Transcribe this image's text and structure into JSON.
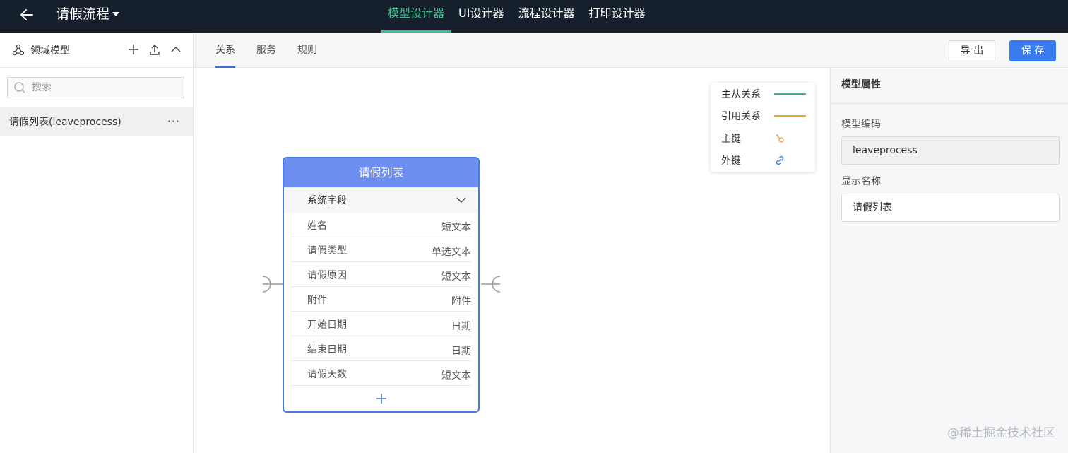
{
  "app": {
    "title": "请假流程",
    "nav_tabs": [
      "模型设计器",
      "UI设计器",
      "流程设计器",
      "打印设计器"
    ],
    "active_tab": "模型设计器"
  },
  "left_panel": {
    "title": "领域模型",
    "search_placeholder": "搜索",
    "items": [
      {
        "label": "请假列表(leaveprocess)"
      }
    ]
  },
  "sub_tabs": [
    "关系",
    "服务",
    "规则"
  ],
  "toolbar": {
    "export_label": "导 出",
    "save_label": "保 存"
  },
  "legend": {
    "items": [
      {
        "label": "主从关系",
        "icon": "solid-line",
        "color": "#4caf8a"
      },
      {
        "label": "引用关系",
        "icon": "solid-line",
        "color": "#e8a53a"
      },
      {
        "label": "主键",
        "icon": "key-icon",
        "color": "#e8a53a"
      },
      {
        "label": "外键",
        "icon": "link-icon",
        "color": "#3a7bf0"
      }
    ]
  },
  "entity": {
    "title": "请假列表",
    "group_label": "系统字段",
    "fields": [
      {
        "name": "姓名",
        "type": "短文本"
      },
      {
        "name": "请假类型",
        "type": "单选文本"
      },
      {
        "name": "请假原因",
        "type": "短文本"
      },
      {
        "name": "附件",
        "type": "附件"
      },
      {
        "name": "开始日期",
        "type": "日期"
      },
      {
        "name": "结束日期",
        "type": "日期"
      },
      {
        "name": "请假天数",
        "type": "短文本"
      }
    ]
  },
  "properties": {
    "title": "模型属性",
    "code_label": "模型编码",
    "code_value": "leaveprocess",
    "name_label": "显示名称",
    "name_value": "请假列表"
  },
  "watermark": "@稀土掘金技术社区",
  "colors": {
    "accent": "#3a7bf0",
    "topbar": "#15202c",
    "active_nav": "#3fbf8f",
    "entity_header": "#6d8ef0"
  }
}
